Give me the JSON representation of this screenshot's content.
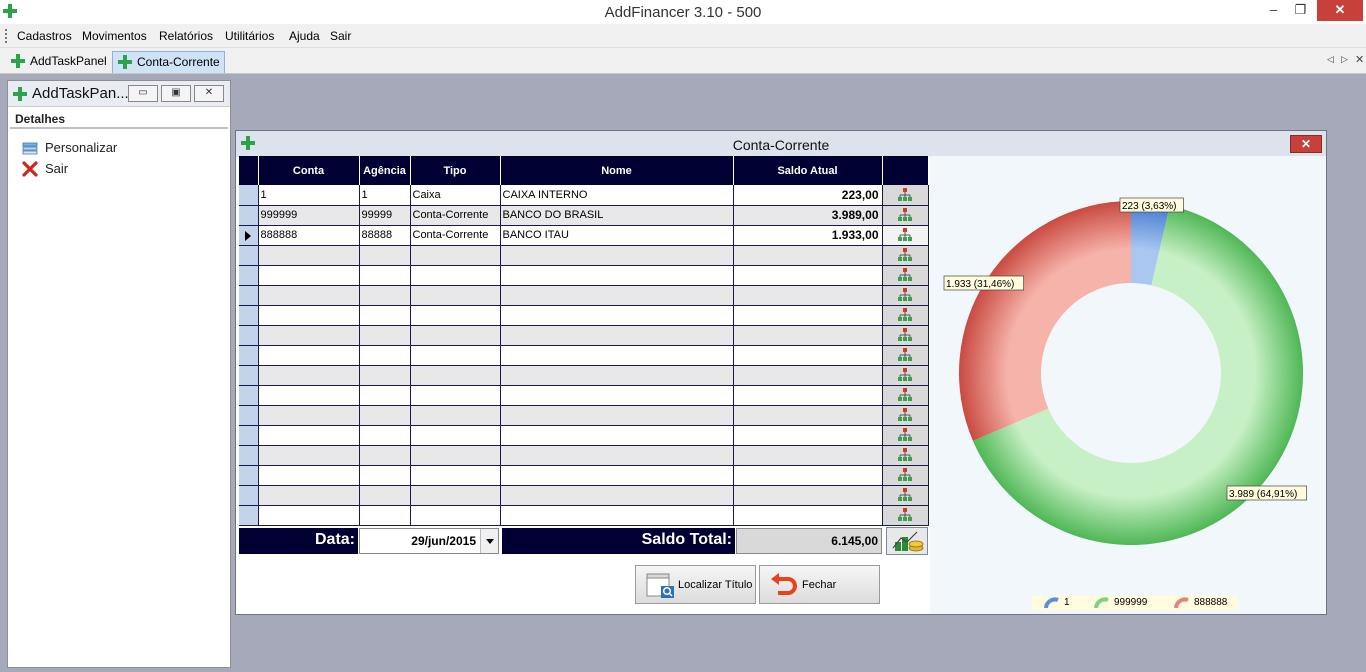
{
  "app": {
    "title": "AddFinancer 3.10 - 500",
    "window_min": "–",
    "window_max": "❐",
    "window_close": "✕"
  },
  "menu": [
    "Cadastros",
    "Movimentos",
    "Relatórios",
    "Utilitários",
    "Ajuda",
    "Sair"
  ],
  "tabs": [
    {
      "label": "AddTaskPanel",
      "active": false
    },
    {
      "label": "Conta-Corrente",
      "active": true
    }
  ],
  "tab_nav": {
    "prev": "◁",
    "next": "▷",
    "close": "✕"
  },
  "left_panel": {
    "title": "AddTaskPan...",
    "buttons": {
      "minimize": "▭",
      "restore": "▣",
      "close": "✕"
    },
    "section": "Detalhes",
    "items": [
      {
        "label": "Personalizar",
        "icon": "settings-icon"
      },
      {
        "label": "Sair",
        "icon": "x-icon"
      }
    ]
  },
  "form": {
    "title": "Conta-Corrente",
    "close": "✕",
    "columns": [
      "Conta",
      "Agência",
      "Tipo",
      "Nome",
      "Saldo Atual"
    ],
    "rows": [
      {
        "conta": "1",
        "agencia": "1",
        "tipo": "Caixa",
        "nome": "CAIXA INTERNO",
        "saldo": "223,00"
      },
      {
        "conta": "999999",
        "agencia": "99999",
        "tipo": "Conta-Corrente",
        "nome": "BANCO DO BRASIL",
        "saldo": "3.989,00"
      },
      {
        "conta": "888888",
        "agencia": "88888",
        "tipo": "Conta-Corrente",
        "nome": "BANCO ITAU",
        "saldo": "1.933,00"
      }
    ],
    "current_row": 2,
    "date_label": "Data:",
    "date_value": "29/jun/2015",
    "total_label": "Saldo Total:",
    "total_value": "6.145,00",
    "buttons": {
      "localizar": "Localizar Título",
      "fechar": "Fechar"
    }
  },
  "chart_data": {
    "type": "pie",
    "variant": "donut",
    "categories": [
      "1",
      "999999",
      "888888"
    ],
    "values": [
      223,
      3989,
      1933
    ],
    "data_labels": [
      "223 (3,63%)",
      "3.989 (64,91%)",
      "1.933 (31,46%)"
    ],
    "colors": [
      "#5b8fd9",
      "#62c466",
      "#d95c52"
    ],
    "legend": "bottom-center"
  }
}
